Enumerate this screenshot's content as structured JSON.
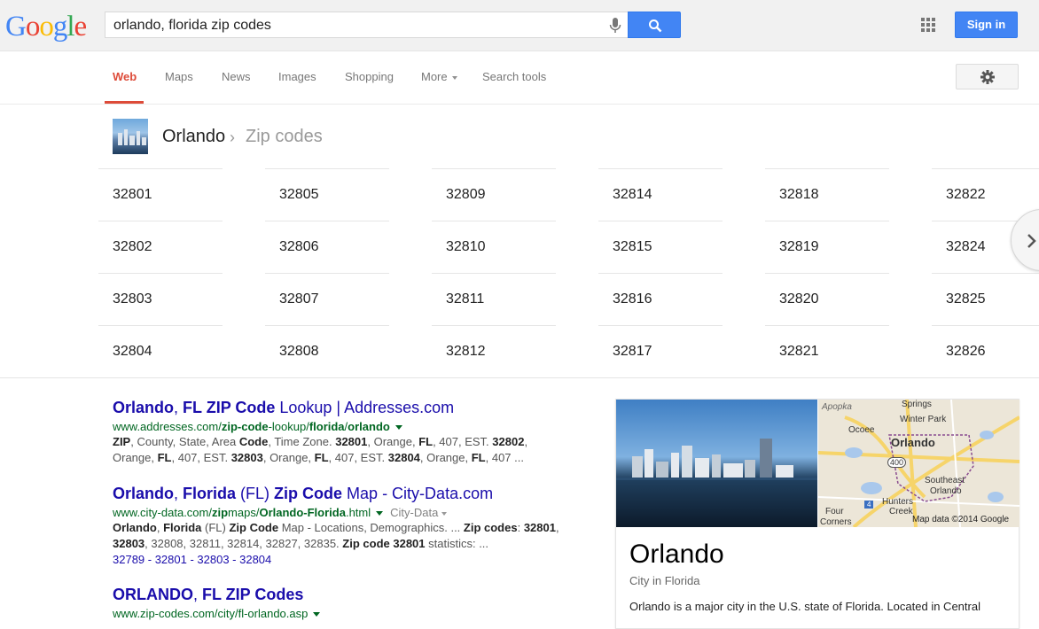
{
  "logo": {
    "letters": [
      {
        "ch": "G",
        "color": "#4285f4"
      },
      {
        "ch": "o",
        "color": "#ea4335"
      },
      {
        "ch": "o",
        "color": "#fbbc05"
      },
      {
        "ch": "g",
        "color": "#4285f4"
      },
      {
        "ch": "l",
        "color": "#34a853"
      },
      {
        "ch": "e",
        "color": "#ea4335"
      }
    ]
  },
  "search": {
    "query": "orlando, florida zip codes"
  },
  "header": {
    "signin_label": "Sign in"
  },
  "tabs": [
    {
      "label": "Web",
      "active": true
    },
    {
      "label": "Maps"
    },
    {
      "label": "News"
    },
    {
      "label": "Images"
    },
    {
      "label": "Shopping"
    },
    {
      "label": "More"
    },
    {
      "label": "Search tools"
    }
  ],
  "entity": {
    "title": "Orlando",
    "separator": "›",
    "subtitle": "Zip codes"
  },
  "zip_columns": [
    [
      "32801",
      "32802",
      "32803",
      "32804"
    ],
    [
      "32805",
      "32806",
      "32807",
      "32808"
    ],
    [
      "32809",
      "32810",
      "32811",
      "32812"
    ],
    [
      "32814",
      "32815",
      "32816",
      "32817"
    ],
    [
      "32818",
      "32819",
      "32820",
      "32821"
    ],
    [
      "32822",
      "32824",
      "32825",
      "32826"
    ]
  ],
  "results": [
    {
      "title_parts": [
        {
          "t": "Orlando",
          "b": true
        },
        {
          "t": ", ",
          "b": false
        },
        {
          "t": "FL ZIP Code",
          "b": true
        },
        {
          "t": " Lookup | Addresses.com",
          "b": false
        }
      ],
      "url_parts": [
        {
          "t": "www.addresses.com/",
          "b": false
        },
        {
          "t": "zip-code",
          "b": true
        },
        {
          "t": "-lookup/",
          "b": false
        },
        {
          "t": "florida",
          "b": true
        },
        {
          "t": "/",
          "b": false
        },
        {
          "t": "orlando",
          "b": true
        }
      ],
      "category": "",
      "snippet_lines": [
        [
          {
            "t": "ZIP",
            "b": true
          },
          {
            "t": ", County, State, Area ",
            "b": false
          },
          {
            "t": "Code",
            "b": true
          },
          {
            "t": ", Time Zone. ",
            "b": false
          },
          {
            "t": "32801",
            "b": true
          },
          {
            "t": ", Orange, ",
            "b": false
          },
          {
            "t": "FL",
            "b": true
          },
          {
            "t": ", 407, EST. ",
            "b": false
          },
          {
            "t": "32802",
            "b": true
          },
          {
            "t": ",",
            "b": false
          }
        ],
        [
          {
            "t": "Orange, ",
            "b": false
          },
          {
            "t": "FL",
            "b": true
          },
          {
            "t": ", 407, EST. ",
            "b": false
          },
          {
            "t": "32803",
            "b": true
          },
          {
            "t": ", Orange, ",
            "b": false
          },
          {
            "t": "FL",
            "b": true
          },
          {
            "t": ", 407, EST. ",
            "b": false
          },
          {
            "t": "32804",
            "b": true
          },
          {
            "t": ", Orange, ",
            "b": false
          },
          {
            "t": "FL",
            "b": true
          },
          {
            "t": ", 407 ...",
            "b": false
          }
        ]
      ],
      "links": ""
    },
    {
      "title_parts": [
        {
          "t": "Orlando",
          "b": true
        },
        {
          "t": ", ",
          "b": false
        },
        {
          "t": "Florida",
          "b": true
        },
        {
          "t": " (FL) ",
          "b": false
        },
        {
          "t": "Zip Code",
          "b": true
        },
        {
          "t": " Map - City-Data.com",
          "b": false
        }
      ],
      "url_parts": [
        {
          "t": "www.city-data.com/",
          "b": false
        },
        {
          "t": "zip",
          "b": true
        },
        {
          "t": "maps/",
          "b": false
        },
        {
          "t": "Orlando-Florida",
          "b": true
        },
        {
          "t": ".html",
          "b": false
        }
      ],
      "category": "City-Data",
      "snippet_lines": [
        [
          {
            "t": "Orlando",
            "b": true
          },
          {
            "t": ", ",
            "b": false
          },
          {
            "t": "Florida",
            "b": true
          },
          {
            "t": " (FL) ",
            "b": false
          },
          {
            "t": "Zip Code",
            "b": true
          },
          {
            "t": " Map - Locations, Demographics. ... ",
            "b": false
          },
          {
            "t": "Zip codes",
            "b": true
          },
          {
            "t": ": ",
            "b": false
          },
          {
            "t": "32801",
            "b": true
          },
          {
            "t": ",",
            "b": false
          }
        ],
        [
          {
            "t": "32803",
            "b": true
          },
          {
            "t": ", 32808, 32811, 32814, 32827, 32835. ",
            "b": false
          },
          {
            "t": "Zip code 32801",
            "b": true
          },
          {
            "t": " statistics: ...",
            "b": false
          }
        ]
      ],
      "links": "32789 - 32801 - 32803 - 32804"
    },
    {
      "title_parts": [
        {
          "t": "ORLANDO",
          "b": true
        },
        {
          "t": ", ",
          "b": false
        },
        {
          "t": "FL ZIP Codes",
          "b": true
        }
      ],
      "url_parts": [
        {
          "t": "www.zip-codes.com/city/fl-orlando.asp",
          "b": false
        }
      ],
      "category": "",
      "snippet_lines": [],
      "links": ""
    }
  ],
  "knowledge_panel": {
    "title": "Orlando",
    "subtitle": "City in Florida",
    "description": "Orlando is a major city in the U.S. state of Florida. Located in Central",
    "map": {
      "labels": {
        "apopka": "Apopka",
        "springs": "Springs",
        "winter_park": "Winter Park",
        "ocoee": "Ocoee",
        "orlando": "Orlando",
        "hwy400": "400",
        "southeast1": "Southeast",
        "southeast2": "Orlando",
        "four_corners1": "Four",
        "four_corners2": "Corners",
        "hunters_creek1": "Hunters",
        "hunters_creek2": "Creek",
        "hwy4": "4",
        "credit": "Map data ©2014 Google"
      }
    }
  }
}
